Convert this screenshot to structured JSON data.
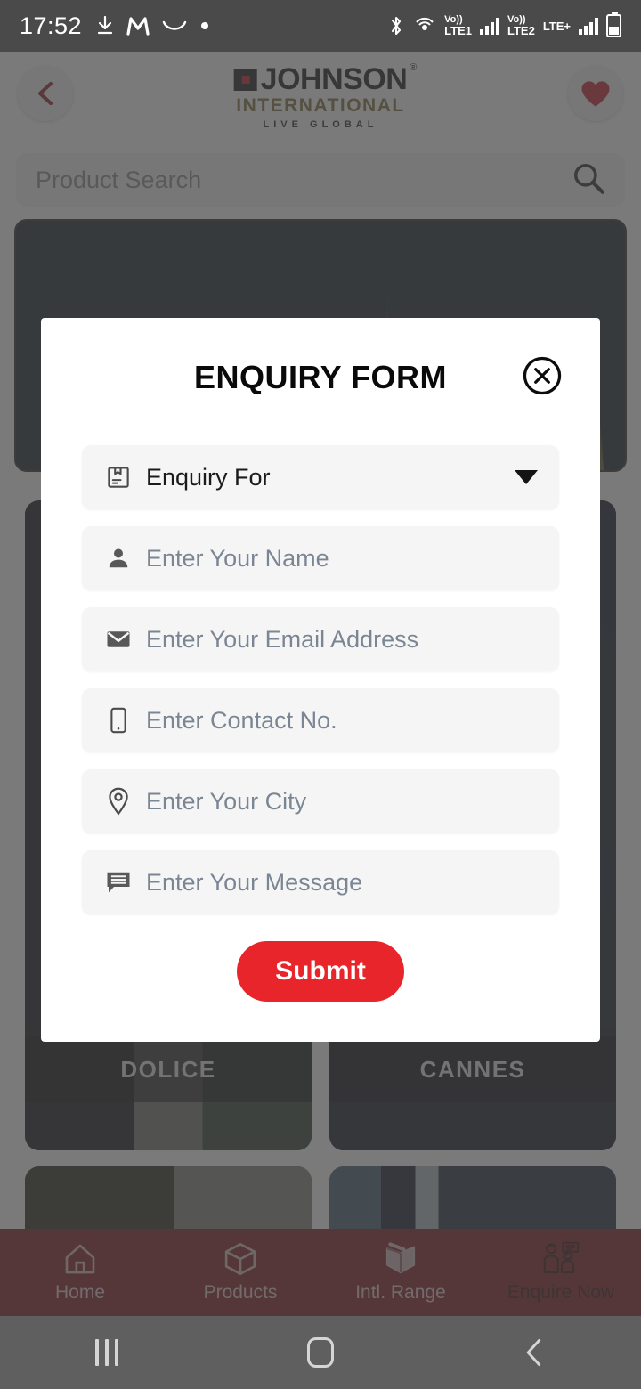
{
  "status_bar": {
    "time": "17:52",
    "left_icons": [
      "download-icon",
      "m-app-icon",
      "curve-icon",
      "dot-icon"
    ],
    "right_icons": [
      "bluetooth-icon",
      "hotspot-icon"
    ],
    "sim1": {
      "volte": "Vo))",
      "label": "LTE1"
    },
    "sim2": {
      "volte": "Vo))",
      "label": "LTE2",
      "plus": "LTE+"
    }
  },
  "app_header": {
    "back_icon": "chevron-left-icon",
    "favorite_icon": "heart-icon",
    "logo": {
      "name": "JOHNSON",
      "registered": "®",
      "subtitle": "INTERNATIONAL",
      "tagline": "LIVE GLOBAL"
    }
  },
  "search": {
    "placeholder": "Product Search",
    "icon": "search-icon"
  },
  "cards": [
    {
      "label": "DOLICE"
    },
    {
      "label": "CANNES"
    }
  ],
  "bottom_nav": {
    "items": [
      {
        "label": "Home",
        "icon": "home-icon",
        "active": false
      },
      {
        "label": "Products",
        "icon": "box-icon",
        "active": false
      },
      {
        "label": "Intl. Range",
        "icon": "open-box-icon",
        "active": false
      },
      {
        "label": "Enquire Now",
        "icon": "support-agent-icon",
        "active": true
      }
    ],
    "background_color": "#7d1117",
    "active_text_color": "#2a0507",
    "inactive_text_color": "#e3c6c8"
  },
  "system_nav": {
    "recents": "recents-icon",
    "home": "home-circle-icon",
    "back": "back-chevron-icon"
  },
  "modal": {
    "title": "ENQUIRY FORM",
    "close_icon": "close-circle-icon",
    "fields": [
      {
        "label": "Enquiry For",
        "icon": "package-icon",
        "type": "select",
        "caret": "chevron-down-icon"
      },
      {
        "placeholder": "Enter Your Name",
        "icon": "person-icon",
        "type": "text",
        "value": ""
      },
      {
        "placeholder": "Enter Your Email Address",
        "icon": "mail-icon",
        "type": "email",
        "value": ""
      },
      {
        "placeholder": "Enter Contact No.",
        "icon": "phone-icon",
        "type": "tel",
        "value": ""
      },
      {
        "placeholder": "Enter Your City",
        "icon": "location-pin-icon",
        "type": "text",
        "value": ""
      },
      {
        "placeholder": "Enter Your Message",
        "icon": "message-icon",
        "type": "text",
        "value": ""
      }
    ],
    "submit_label": "Submit",
    "submit_color": "#e8252b"
  }
}
